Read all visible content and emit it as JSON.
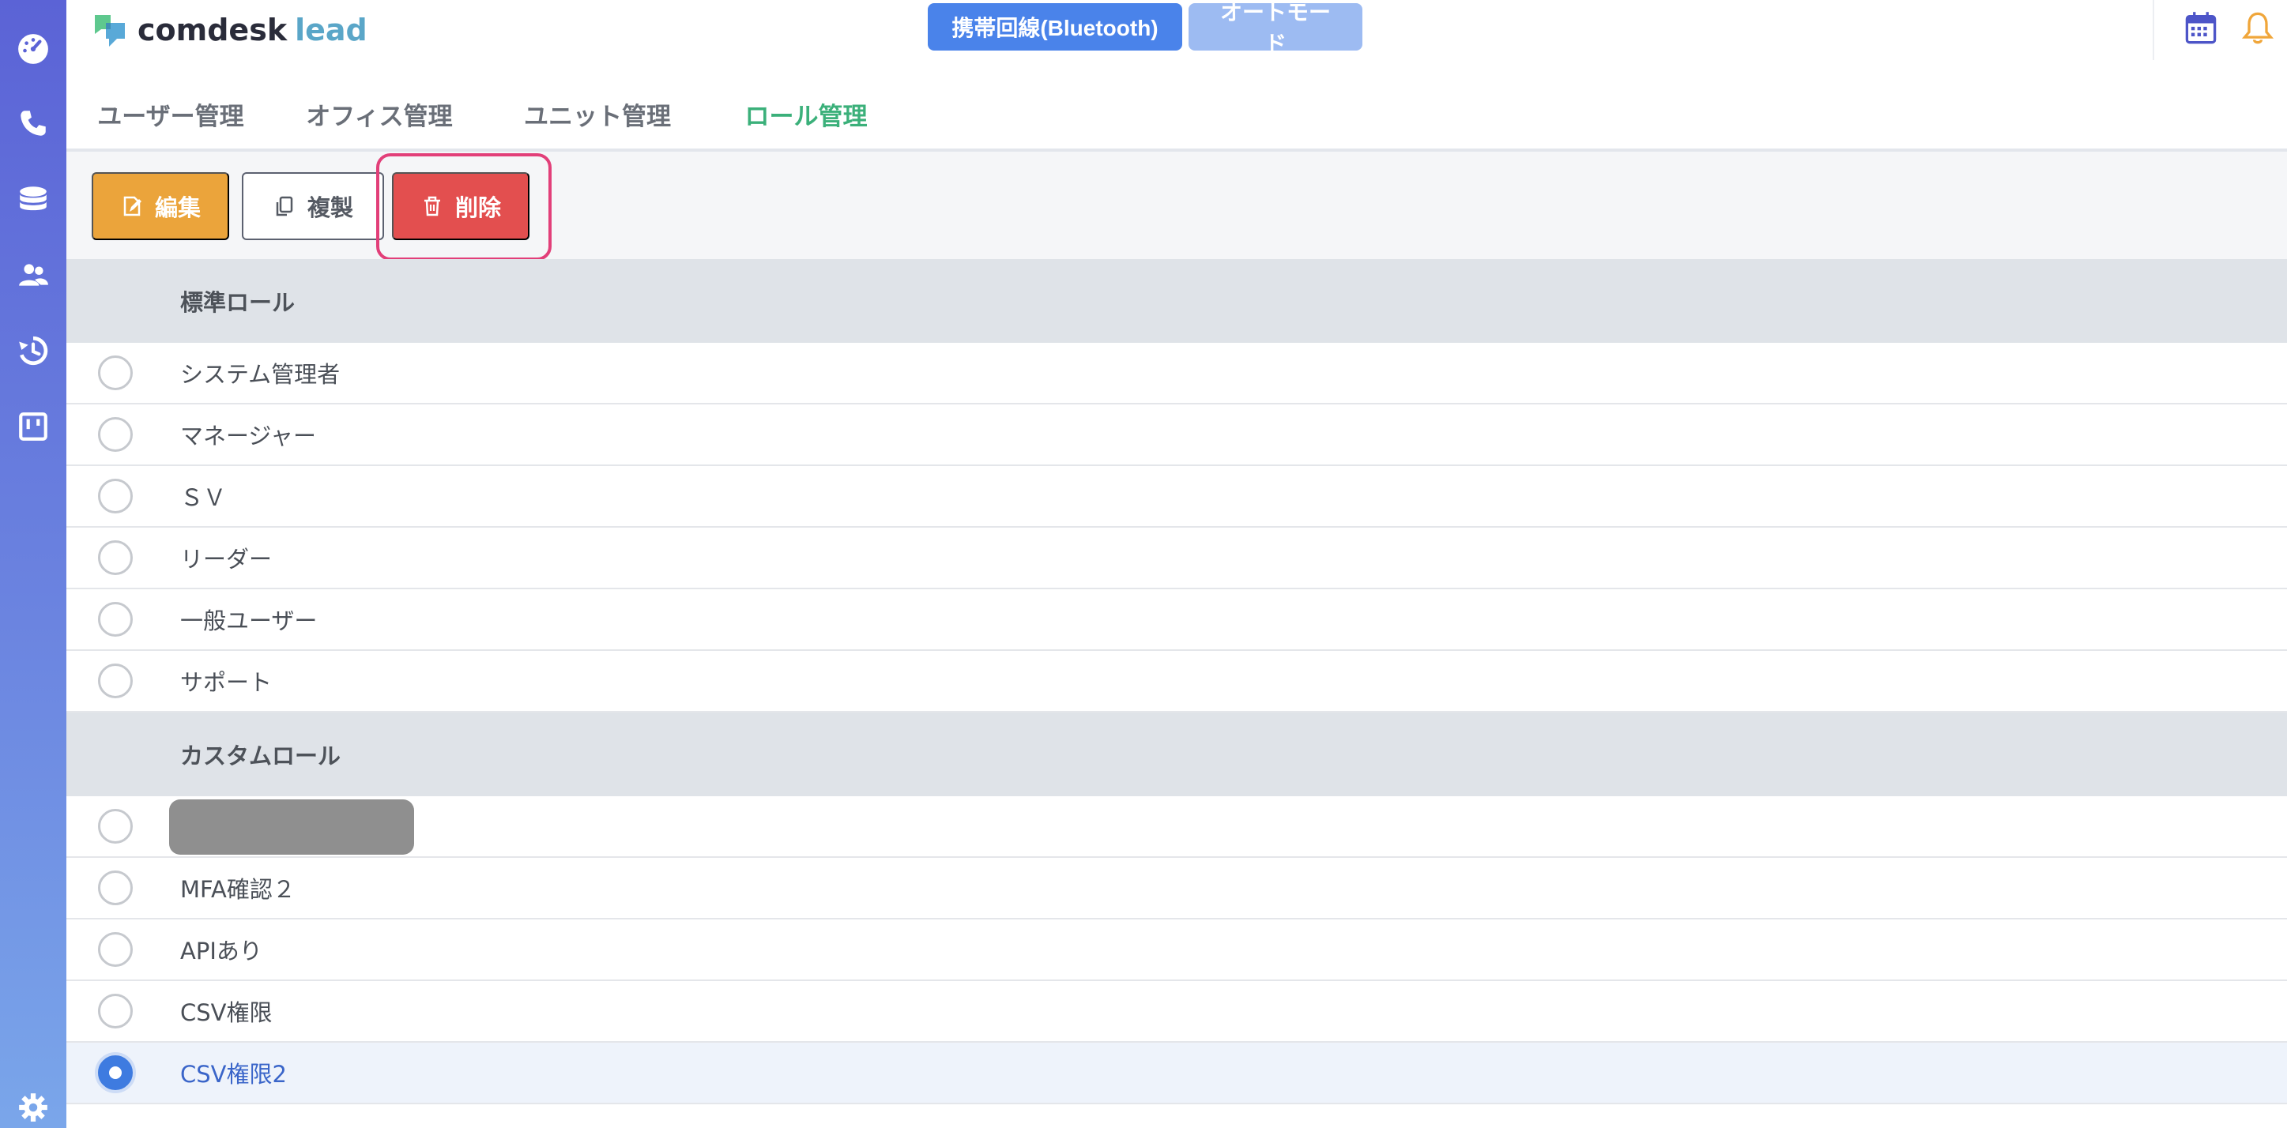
{
  "app": {
    "logo_name": "comdesk",
    "logo_suffix": "lead"
  },
  "header": {
    "bluetooth_label": "携帯回線(Bluetooth)",
    "auto_mode_label": "オートモード"
  },
  "tabs": [
    {
      "label": "ユーザー管理"
    },
    {
      "label": "オフィス管理"
    },
    {
      "label": "ユニット管理"
    },
    {
      "label": "ロール管理"
    }
  ],
  "toolbar": {
    "edit_label": "編集",
    "copy_label": "複製",
    "delete_label": "削除"
  },
  "standard_roles": {
    "heading": "標準ロール",
    "items": [
      {
        "label": "システム管理者"
      },
      {
        "label": "マネージャー"
      },
      {
        "label": "ＳＶ"
      },
      {
        "label": "リーダー"
      },
      {
        "label": "一般ユーザー"
      },
      {
        "label": "サポート"
      }
    ]
  },
  "custom_roles": {
    "heading": "カスタムロール",
    "items": [
      {
        "label": ""
      },
      {
        "label": "MFA確認２"
      },
      {
        "label": "APIあり"
      },
      {
        "label": "CSV権限"
      },
      {
        "label": "CSV権限2"
      }
    ]
  },
  "colors": {
    "accent_tab": "#3bb07a",
    "edit": "#eba43b",
    "delete": "#e34f4f",
    "primary": "#4a83ea",
    "highlight": "#e23f79"
  }
}
